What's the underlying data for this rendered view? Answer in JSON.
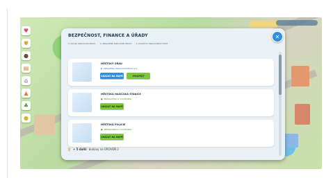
{
  "panel": {
    "title": "Bezpečnost, finance a úřady",
    "subtitles": [
      "2 volná pracovní místa",
      "1 obsazené pracovní místo",
      "4 volných pracovních míst"
    ],
    "close_icon": "close-icon"
  },
  "cards": [
    {
      "name": "Městský úřad",
      "requirement": "Obsazená pracovní místa 2/4",
      "requirement_color": "#2f7fc8",
      "primary_label": "Ukázat na mapě",
      "secondary_label": "Vylepšit"
    },
    {
      "name": "Městská hasičská stanice",
      "requirement": "Připraveno k vylepšení",
      "requirement_color": "#4f9a2a",
      "primary_label": "Ukázat na mapě"
    },
    {
      "name": "Městská policie",
      "requirement": "Připraveno k vylepšení",
      "requirement_color": "#4f9a2a",
      "primary_label": "Ukázat na mapě"
    }
  ],
  "footer": {
    "bold": "+ 5 další",
    "rest": "budovy na ÚROVEŇ 2"
  },
  "sidebar_icons": [
    "heart-icon",
    "shield-icon",
    "paw-icon",
    "briefcase-icon",
    "hospital-icon",
    "school-icon",
    "tree-icon",
    "coins-icon"
  ],
  "colors": {
    "accent_blue": "#2e8fe0",
    "accent_green": "#7cc63a",
    "panel_bg": "#e9f1f7"
  }
}
